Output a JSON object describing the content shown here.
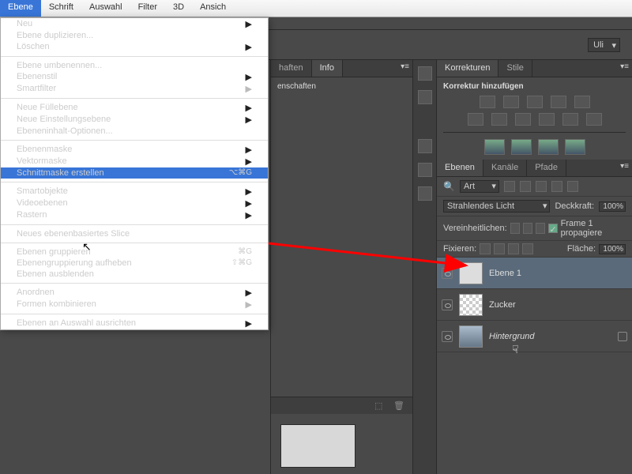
{
  "menubar": [
    "Ebene",
    "Schrift",
    "Auswahl",
    "Filter",
    "3D",
    "Ansich"
  ],
  "dropdown": [
    {
      "label": "Neu",
      "arrow": true
    },
    {
      "label": "Ebene duplizieren..."
    },
    {
      "label": "Löschen",
      "arrow": true
    },
    {
      "sep": true
    },
    {
      "label": "Ebene umbenennen..."
    },
    {
      "label": "Ebenenstil",
      "arrow": true
    },
    {
      "label": "Smartfilter",
      "arrow": true,
      "disabled": true
    },
    {
      "sep": true
    },
    {
      "label": "Neue Füllebene",
      "arrow": true
    },
    {
      "label": "Neue Einstellungsebene",
      "arrow": true
    },
    {
      "label": "Ebeneninhalt-Optionen...",
      "disabled": true
    },
    {
      "sep": true
    },
    {
      "label": "Ebenenmaske",
      "arrow": true
    },
    {
      "label": "Vektormaske",
      "arrow": true
    },
    {
      "label": "Schnittmaske erstellen",
      "shortcut": "⌥⌘G",
      "hl": true
    },
    {
      "sep": true
    },
    {
      "label": "Smartobjekte",
      "arrow": true
    },
    {
      "label": "Videoebenen",
      "arrow": true
    },
    {
      "label": "Rastern",
      "arrow": true
    },
    {
      "sep": true
    },
    {
      "label": "Neues ebenenbasiertes Slice"
    },
    {
      "sep": true
    },
    {
      "label": "Ebenen gruppieren",
      "shortcut": "⌘G"
    },
    {
      "label": "Ebenengruppierung aufheben",
      "shortcut": "⇧⌘G",
      "disabled": true
    },
    {
      "label": "Ebenen ausblenden"
    },
    {
      "sep": true
    },
    {
      "label": "Anordnen",
      "arrow": true
    },
    {
      "label": "Formen kombinieren",
      "arrow": true,
      "disabled": true
    },
    {
      "sep": true
    },
    {
      "label": "Ebenen an Auswahl ausrichten",
      "arrow": true
    }
  ],
  "toolbar": {
    "preset": "Uli"
  },
  "props": {
    "tab1": "haften",
    "tab2": "Info",
    "header": "enschaften"
  },
  "korrekturen": {
    "tabs": [
      "Korrekturen",
      "Stile"
    ],
    "title": "Korrektur hinzufügen"
  },
  "layers": {
    "tabs": [
      "Ebenen",
      "Kanäle",
      "Pfade"
    ],
    "filter": "Art",
    "blend": "Strahlendes Licht",
    "opacity_label": "Deckkraft:",
    "opacity": "100%",
    "unify_label": "Vereinheitlichen:",
    "propagate": "Frame 1 propagiere",
    "lock_label": "Fixieren:",
    "fill_label": "Fläche:",
    "fill": "100%",
    "items": [
      {
        "name": "Ebene 1",
        "sel": true,
        "thumb": "plain"
      },
      {
        "name": "Zucker",
        "thumb": "checker"
      },
      {
        "name": "Hintergrund",
        "thumb": "img",
        "italic": true,
        "locked": true
      }
    ]
  }
}
